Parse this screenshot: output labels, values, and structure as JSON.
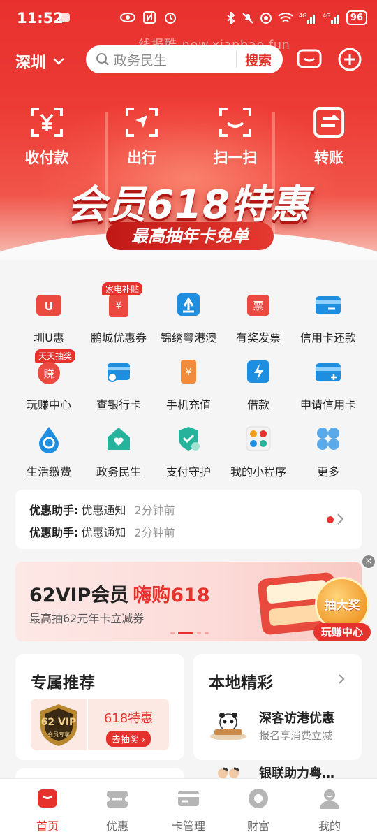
{
  "status": {
    "time": "11:52",
    "battery": "96"
  },
  "watermark": "线报酷-new.xianbao.fun",
  "header": {
    "city": "深圳",
    "search_placeholder": "政务民生",
    "search_button": "搜索"
  },
  "quick_actions": [
    {
      "label": "收付款",
      "icon": "yuan-scan-icon"
    },
    {
      "label": "出行",
      "icon": "navigation-icon"
    },
    {
      "label": "扫一扫",
      "icon": "scan-icon"
    },
    {
      "label": "转账",
      "icon": "transfer-icon"
    }
  ],
  "promo": {
    "title": "会员618特惠",
    "subtitle": "最高抽年卡免单"
  },
  "grid": [
    {
      "label": "圳U惠",
      "icon": "u-coupon-icon",
      "tag": ""
    },
    {
      "label": "鹏城优惠券",
      "icon": "coupon-icon",
      "tag": "家电补贴"
    },
    {
      "label": "锦绣粤港澳",
      "icon": "bay-area-icon",
      "tag": ""
    },
    {
      "label": "有奖发票",
      "icon": "invoice-icon",
      "tag": ""
    },
    {
      "label": "信用卡还款",
      "icon": "card-repay-icon",
      "tag": ""
    },
    {
      "label": "玩赚中心",
      "icon": "earn-icon",
      "tag": "天天抽奖"
    },
    {
      "label": "查银行卡",
      "icon": "bank-card-icon",
      "tag": ""
    },
    {
      "label": "手机充值",
      "icon": "phone-topup-icon",
      "tag": ""
    },
    {
      "label": "借款",
      "icon": "loan-icon",
      "tag": ""
    },
    {
      "label": "申请信用卡",
      "icon": "apply-card-icon",
      "tag": ""
    },
    {
      "label": "生活缴费",
      "icon": "utility-icon",
      "tag": ""
    },
    {
      "label": "政务民生",
      "icon": "gov-icon",
      "tag": ""
    },
    {
      "label": "支付守护",
      "icon": "shield-icon",
      "tag": ""
    },
    {
      "label": "我的小程序",
      "icon": "mini-program-icon",
      "tag": ""
    },
    {
      "label": "更多",
      "icon": "more-icon",
      "tag": ""
    }
  ],
  "notices": [
    {
      "key": "优惠助手:",
      "value": "优惠通知",
      "time": "2分钟前"
    },
    {
      "key": "优惠助手:",
      "value": "优惠通知",
      "time": "2分钟前"
    }
  ],
  "banner": {
    "title": "62VIP会员",
    "title_red": "嗨购618",
    "subtitle": "最高抽62元年卡立减券",
    "close": "×"
  },
  "lottery": {
    "big": "抽大奖",
    "pill": "玩赚中心"
  },
  "exclusive": {
    "title": "专属推荐",
    "offer": "618特惠",
    "action": "去抽奖 ›",
    "vip_text": "62 VIP",
    "vip_sub": "会员专享"
  },
  "local": {
    "title": "本地精彩",
    "items": [
      {
        "title": "深客访港优惠",
        "sub": "报名享消费立减"
      },
      {
        "title": "银联助力粤…",
        "sub": ""
      }
    ]
  },
  "tabs": [
    {
      "label": "首页",
      "icon": "home-icon",
      "active": true
    },
    {
      "label": "优惠",
      "icon": "discount-icon",
      "active": false
    },
    {
      "label": "卡管理",
      "icon": "card-icon",
      "active": false
    },
    {
      "label": "财富",
      "icon": "wealth-icon",
      "active": false
    },
    {
      "label": "我的",
      "icon": "profile-icon",
      "active": false
    }
  ],
  "colors": {
    "brand_red": "#e5322c"
  }
}
